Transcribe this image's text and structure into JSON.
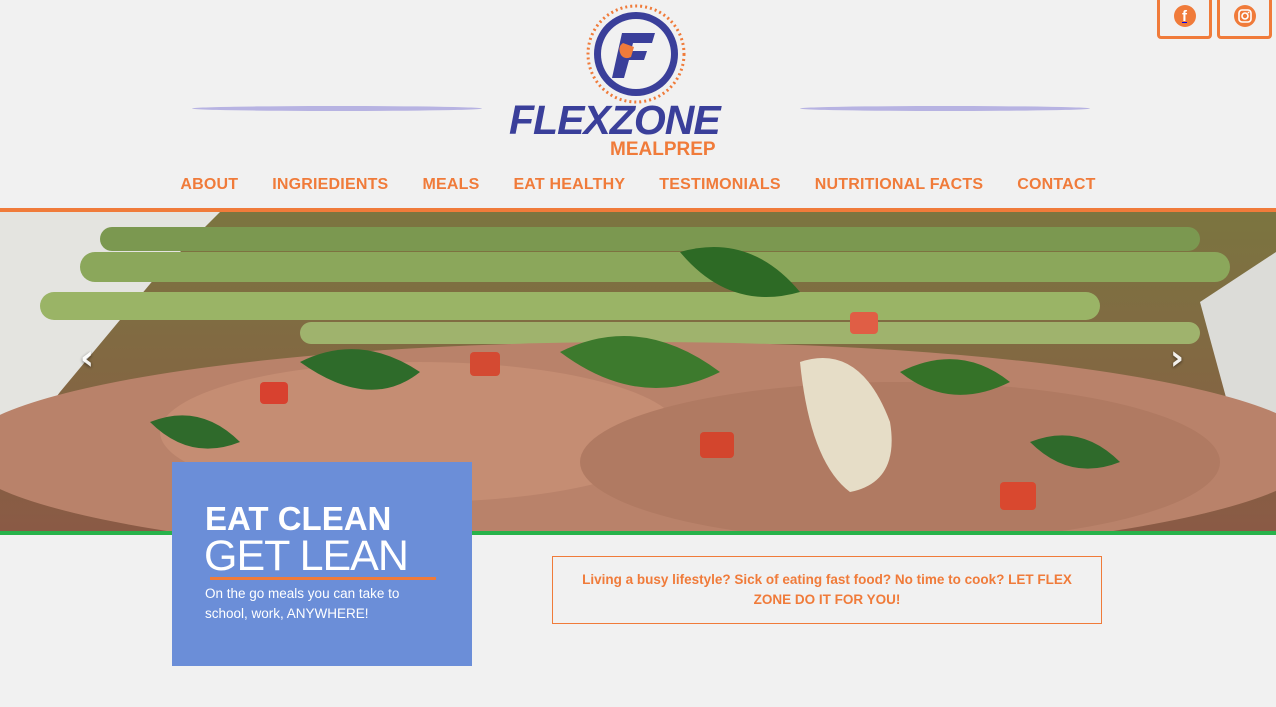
{
  "social": {
    "facebook_glyph": "f",
    "instagram_glyph": "◎"
  },
  "logo": {
    "badge_letter": "F",
    "title": "FLEXZONE",
    "subtitle": "MEALPREP"
  },
  "nav": {
    "items": [
      {
        "label": "ABOUT"
      },
      {
        "label": "INGRIEDIENTS"
      },
      {
        "label": "MEALS"
      },
      {
        "label": "EAT HEALTHY"
      },
      {
        "label": "TESTIMONIALS"
      },
      {
        "label": "NUTRITIONAL FACTS"
      },
      {
        "label": "CONTACT"
      }
    ]
  },
  "carousel": {
    "prev_glyph": "‹",
    "next_glyph": "›"
  },
  "caption": {
    "heading_1": "EAT CLEAN",
    "heading_2": "GET LEAN",
    "body": "On the go meals you can take to school, work, ANYWHERE!"
  },
  "callout": {
    "text": "Living a busy lifestyle? Sick of eating fast food? No time to cook? LET FLEX ZONE DO IT FOR YOU!"
  },
  "colors": {
    "accent": "#f07b3a",
    "brand_blue": "#3a3f9a",
    "card_blue": "#6b8ed8",
    "green_rule": "#28b24b",
    "background": "#f1f1f1"
  }
}
